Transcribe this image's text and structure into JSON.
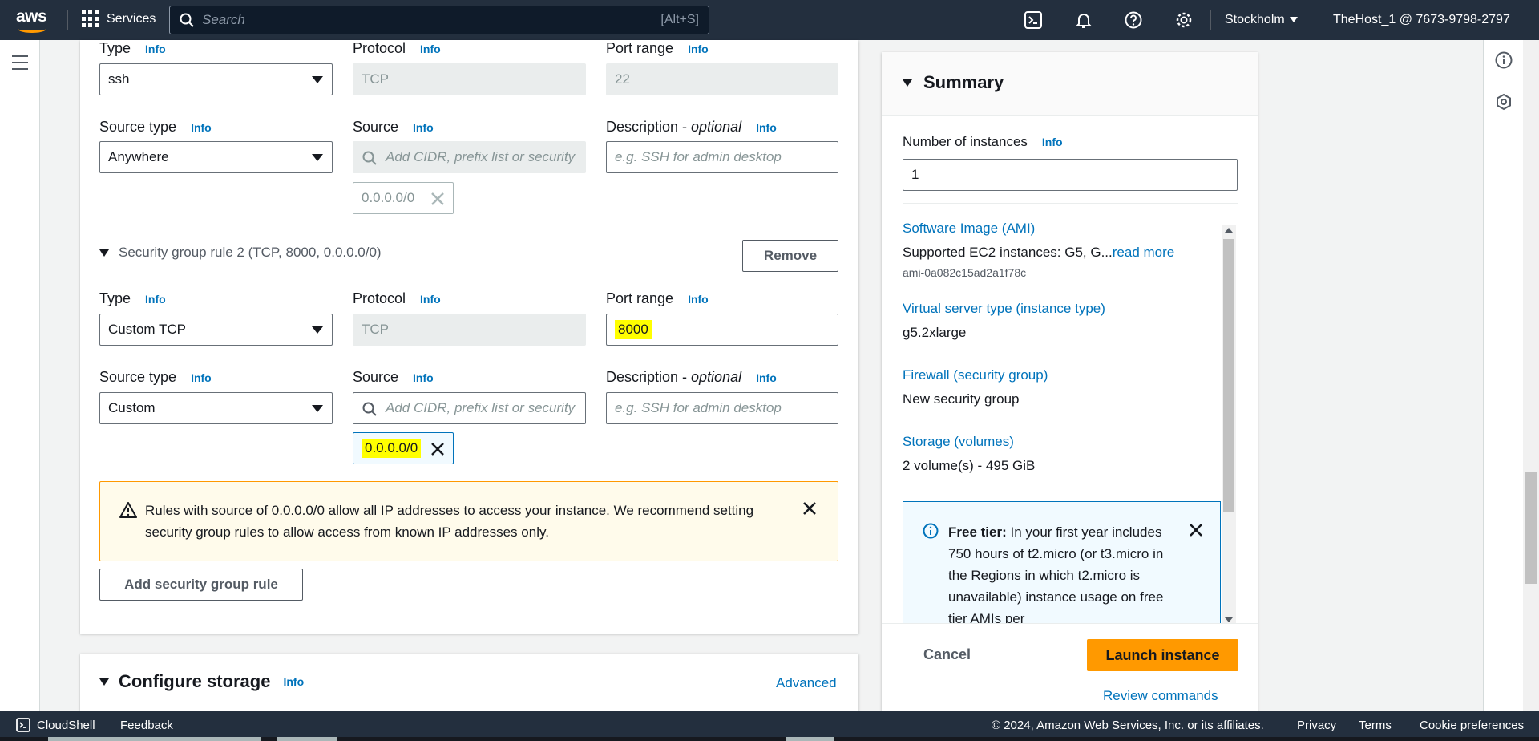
{
  "topnav": {
    "logo_text": "aws",
    "services_label": "Services",
    "search_placeholder": "Search",
    "search_shortcut": "[Alt+S]",
    "region": "Stockholm",
    "account": "TheHost_1 @ 7673-9798-2797"
  },
  "common": {
    "info": "Info",
    "optional": "optional"
  },
  "rule1": {
    "type_label": "Type",
    "type_value": "ssh",
    "protocol_label": "Protocol",
    "protocol_value": "TCP",
    "port_label": "Port range",
    "port_value": "22",
    "source_type_label": "Source type",
    "source_type_value": "Anywhere",
    "source_label": "Source",
    "source_placeholder": "Add CIDR, prefix list or security",
    "desc_label": "Description - ",
    "desc_placeholder": "e.g. SSH for admin desktop",
    "cidr_token": "0.0.0.0/0"
  },
  "rule2": {
    "header": "Security group rule 2 (TCP, 8000, 0.0.0.0/0)",
    "remove_label": "Remove",
    "type_label": "Type",
    "type_value": "Custom TCP",
    "protocol_label": "Protocol",
    "protocol_value": "TCP",
    "port_label": "Port range",
    "port_value": "8000",
    "source_type_label": "Source type",
    "source_type_value": "Custom",
    "source_label": "Source",
    "source_placeholder": "Add CIDR, prefix list or security",
    "desc_label": "Description - ",
    "desc_placeholder": "e.g. SSH for admin desktop",
    "cidr_token": "0.0.0.0/0"
  },
  "warning": {
    "text": "Rules with source of 0.0.0.0/0 allow all IP addresses to access your instance. We recommend setting security group rules to allow access from known IP addresses only."
  },
  "add_rule_label": "Add security group rule",
  "storage": {
    "title": "Configure storage",
    "info": "Info",
    "advanced": "Advanced"
  },
  "summary": {
    "title": "Summary",
    "num_instances_label": "Number of instances",
    "num_instances_value": "1",
    "ami_label": "Software Image (AMI)",
    "ami_value": "Supported EC2 instances: G5, G...",
    "ami_read_more": "read more",
    "ami_id": "ami-0a082c15ad2a1f78c",
    "instance_type_label": "Virtual server type (instance type)",
    "instance_type_value": "g5.2xlarge",
    "firewall_label": "Firewall (security group)",
    "firewall_value": "New security group",
    "storage_label": "Storage (volumes)",
    "storage_value": "2 volume(s) - 495 GiB",
    "freetier_bold": "Free tier:",
    "freetier_text": " In your first year includes 750 hours of t2.micro (or t3.micro in the Regions in which t2.micro is unavailable) instance usage on free tier AMIs per",
    "cancel": "Cancel",
    "launch": "Launch instance",
    "review": "Review commands"
  },
  "footer": {
    "cloudshell": "CloudShell",
    "feedback": "Feedback",
    "copyright": "© 2024, Amazon Web Services, Inc. or its affiliates.",
    "privacy": "Privacy",
    "terms": "Terms",
    "cookies": "Cookie preferences"
  },
  "colors": {
    "nav_bg": "#232f3e",
    "accent_orange": "#ff9900",
    "link_blue": "#0073bb",
    "highlight": "#ffff00"
  }
}
